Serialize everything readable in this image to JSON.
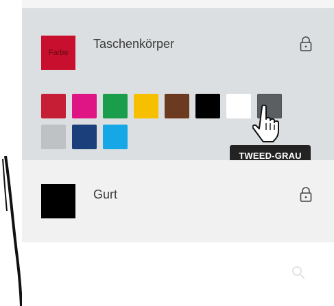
{
  "sections": [
    {
      "title": "Taschenkörper",
      "swatch_label": "Farbe",
      "swatch_color": "#c8102e",
      "lock_icon": "lock-icon",
      "active": true
    },
    {
      "title": "Gurt",
      "swatch_color": "#000000",
      "lock_icon": "lock-icon",
      "active": false
    }
  ],
  "palette": [
    {
      "color": "#c61f35"
    },
    {
      "color": "#e01585"
    },
    {
      "color": "#1a9e4b"
    },
    {
      "color": "#f6c000"
    },
    {
      "color": "#6b3a1f"
    },
    {
      "color": "#000000"
    },
    {
      "color": "#ffffff"
    },
    {
      "color": "#5b5f62",
      "hovered": true
    },
    {
      "color": "#bfc2c4"
    },
    {
      "color": "#1b3f7a"
    },
    {
      "color": "#16a8e6"
    }
  ],
  "tooltip": "TWEED-GRAU",
  "search_icon": "search-icon",
  "cursor_icon": "hand-pointer-icon"
}
